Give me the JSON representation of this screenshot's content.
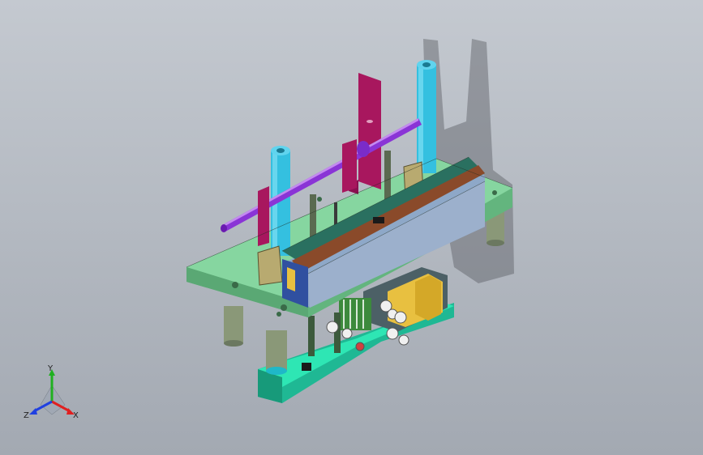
{
  "viewport": {
    "background_top": "#c4c9d0",
    "background_bottom": "#a3a9b2"
  },
  "triad": {
    "x_label": "X",
    "y_label": "Y",
    "z_label": "Z",
    "x_color": "#e02020",
    "y_color": "#20b020",
    "z_color": "#2040e0"
  },
  "model": {
    "base_plate_color": "#86d6a0",
    "bottom_block_color": "#2ee6b4",
    "rail_color": "#2a7060",
    "bar_color": "#9cb0cc",
    "pillar_color": "#34c0e0",
    "rod_color": "#8a34d6",
    "bracket_color": "#a8175e",
    "cylinder_color": "#e8c040",
    "leg_color": "#8a9878"
  }
}
